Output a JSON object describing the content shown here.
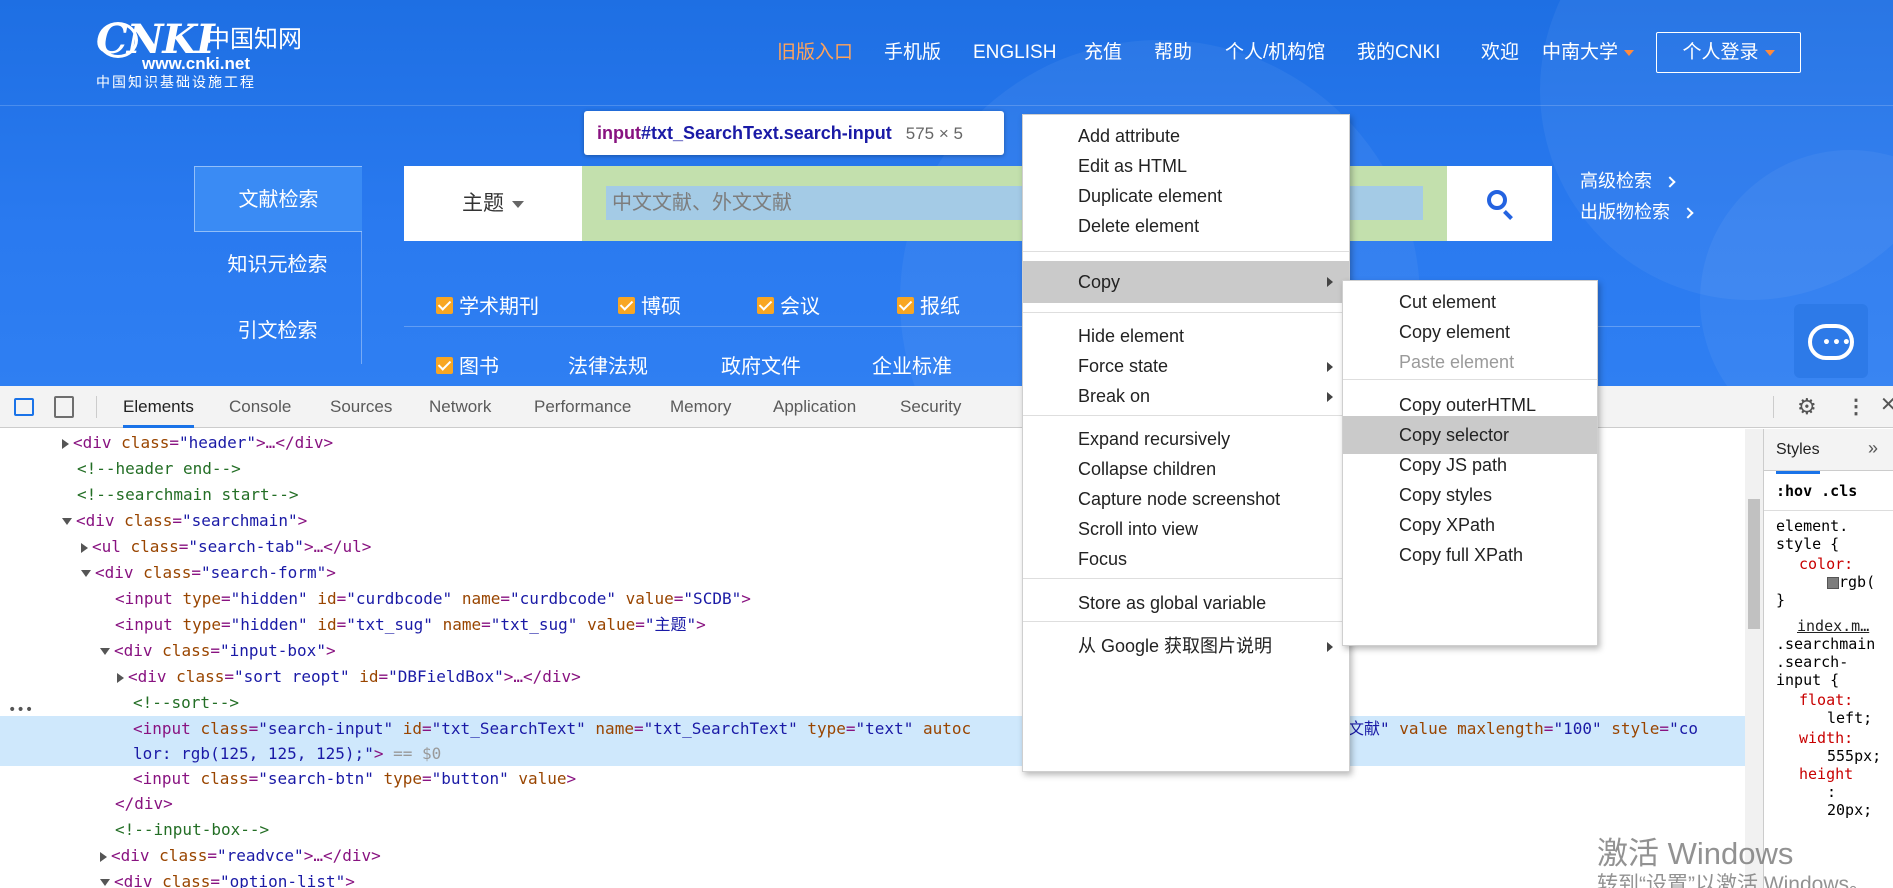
{
  "header": {
    "logo": {
      "wordmark": "CNKI",
      "chinese": "中国知网",
      "url": "www.cnki.net",
      "slogan": "中国知识基础设施工程"
    },
    "nav": [
      "旧版入口",
      "手机版",
      "ENGLISH",
      "充值",
      "帮助",
      "个人/机构馆",
      "我的CNKI",
      "欢迎"
    ],
    "institution": "中南大学",
    "login_label": "个人登录",
    "accent_color": "#ffa35b"
  },
  "search": {
    "side_tabs": [
      "文献检索",
      "知识元检索",
      "引文检索"
    ],
    "field_label": "主题",
    "placeholder": "中文文献、外文文献",
    "advanced_link": "高级检索",
    "publication_link": "出版物检索",
    "options_row1": [
      "学术期刊",
      "博硕",
      "会议",
      "报纸"
    ],
    "options_row2_checked": "图书",
    "options_row2_links": [
      "法律法规",
      "政府文件",
      "企业标准"
    ]
  },
  "tooltip": {
    "tag": "input",
    "selector": "#txt_SearchText.search-input",
    "size": "575 × 5"
  },
  "devtools": {
    "tabs": [
      "Elements",
      "Console",
      "Sources",
      "Network",
      "Performance",
      "Memory",
      "Application",
      "Security"
    ],
    "styles_tab": "Styles",
    "styles_filter": ":hov .cls",
    "styles": {
      "element_style": "element.",
      "style_open": "style {",
      "color_prop": "color:",
      "color_val": "rgb(",
      "close": "}",
      "source_link": "index.m…",
      "sel1": ".searchmain",
      "sel2": ".search-",
      "sel3": "input {",
      "float_prop": "float:",
      "float_val": "left;",
      "width_prop": "width:",
      "width_val": "555px;",
      "height_prop": "height",
      "height_colon": ":",
      "height_val": "20px;"
    }
  },
  "dom": {
    "l1_tag": "<div ",
    "l1_attr": "class",
    "l1_val": "\"header\"",
    "l1_end": ">…</div>",
    "l2": "<!--header end-->",
    "l3": "<!--searchmain start-->",
    "l4_tag": "<div ",
    "l4_attr": "class",
    "l4_val": "\"searchmain\"",
    "l4_end": ">",
    "l5_tag": "<ul ",
    "l5_attr": "class",
    "l5_val": "\"search-tab\"",
    "l5_end": ">…</ul>",
    "l6_tag": "<div ",
    "l6_attr": "class",
    "l6_val": "\"search-form\"",
    "l6_end": ">",
    "l7_tag": "<input ",
    "l7_a1": "type",
    "l7_v1": "\"hidden\"",
    "l7_a2": "id",
    "l7_v2": "\"curdbcode\"",
    "l7_a3": "name",
    "l7_v3": "\"curdbcode\"",
    "l7_a4": "value",
    "l7_v4": "\"SCDB\"",
    "l7_end": ">",
    "l8_tag": "<input ",
    "l8_a1": "type",
    "l8_v1": "\"hidden\"",
    "l8_a2": "id",
    "l8_v2": "\"txt_sug\"",
    "l8_a3": "name",
    "l8_v3": "\"txt_sug\"",
    "l8_a4": "value",
    "l8_v4": "\"主题\"",
    "l8_end": ">",
    "l9_tag": "<div ",
    "l9_attr": "class",
    "l9_val": "\"input-box\"",
    "l9_end": ">",
    "l10_tag": "<div ",
    "l10_a1": "class",
    "l10_v1": "\"sort reopt\"",
    "l10_a2": "id",
    "l10_v2": "\"DBFieldBox\"",
    "l10_end": ">…</div>",
    "l11": "<!--sort-->",
    "l12_tag": "<input ",
    "l12_a1": "class",
    "l12_v1": "\"search-input\"",
    "l12_a2": "id",
    "l12_v2": "\"txt_SearchText\"",
    "l12_a3": "name",
    "l12_v3": "\"txt_SearchText\"",
    "l12_a4": "type",
    "l12_v4": "\"text\"",
    "l12_a5": "autoc",
    "l12_tail_val": "文献、外文文献\"",
    "l12_a6": "value",
    "l12_a7": "maxlength",
    "l12_v7": "\"100\"",
    "l12_a8": "style",
    "l12_v8": "\"co",
    "l13_val": "lor: rgb(125, 125, 125);\"",
    "l13_end": ">",
    "l13_eq": " == $0",
    "l14_tag": "<input ",
    "l14_a1": "class",
    "l14_v1": "\"search-btn\"",
    "l14_a2": "type",
    "l14_v2": "\"button\"",
    "l14_a3": "value",
    "l14_end": ">",
    "l15": "</div>",
    "l16": "<!--input-box-->",
    "l17_tag": "<div ",
    "l17_attr": "class",
    "l17_val": "\"readvce\"",
    "l17_end": ">…</div>",
    "l18_tag": "<div ",
    "l18_attr": "class",
    "l18_val": "\"option-list\"",
    "l18_end": ">"
  },
  "context_menu": {
    "items": [
      "Add attribute",
      "Edit as HTML",
      "Duplicate element",
      "Delete element",
      "Copy",
      "Hide element",
      "Force state",
      "Break on",
      "Expand recursively",
      "Collapse children",
      "Capture node screenshot",
      "Scroll into view",
      "Focus",
      "Store as global variable",
      "从 Google 获取图片说明"
    ],
    "highlighted": "Copy"
  },
  "copy_submenu": {
    "items": [
      "Cut element",
      "Copy element",
      "Paste element",
      "Copy outerHTML",
      "Copy selector",
      "Copy JS path",
      "Copy styles",
      "Copy XPath",
      "Copy full XPath"
    ],
    "highlighted": "Copy selector",
    "disabled": "Paste element"
  },
  "windows_watermark": {
    "line1": "激活 Windows",
    "line2": "转到“设置”以激活 Windows。"
  }
}
